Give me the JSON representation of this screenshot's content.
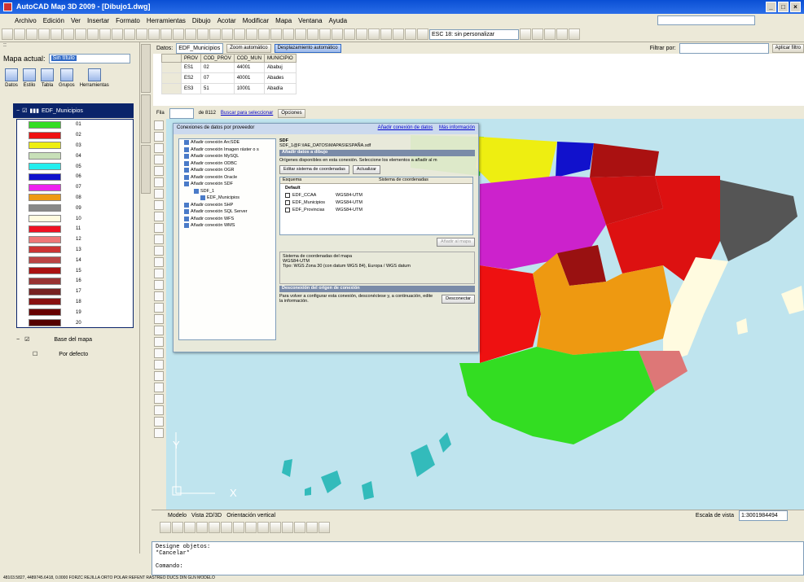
{
  "window": {
    "title": "AutoCAD Map 3D 2009 - [Dibujo1.dwg]"
  },
  "menu": [
    "Archivo",
    "Edición",
    "Ver",
    "Insertar",
    "Formato",
    "Herramientas",
    "Dibujo",
    "Acotar",
    "Modificar",
    "Mapa",
    "Ventana",
    "Ayuda"
  ],
  "toolbar": {
    "layer_select": "ESC 18: sin personalizar"
  },
  "left_panel": {
    "header": "Mapa actual:",
    "map_value": "Sin título",
    "tools": [
      "Datos",
      "Estilo",
      "Tabla",
      "Grupos",
      "Herramientas"
    ],
    "layer_name": "EDF_Municipios",
    "legend": [
      {
        "label": "01",
        "color": "#33dd22"
      },
      {
        "label": "02",
        "color": "#ee1111"
      },
      {
        "label": "03",
        "color": "#eeee11"
      },
      {
        "label": "04",
        "color": "#c8e0b8"
      },
      {
        "label": "05",
        "color": "#22eeee"
      },
      {
        "label": "06",
        "color": "#1111cc"
      },
      {
        "label": "07",
        "color": "#ee22ee"
      },
      {
        "label": "08",
        "color": "#ee9911"
      },
      {
        "label": "09",
        "color": "#888888"
      },
      {
        "label": "10",
        "color": "#fffbe0"
      },
      {
        "label": "11",
        "color": "#ee1122"
      },
      {
        "label": "12",
        "color": "#ee7777"
      },
      {
        "label": "13",
        "color": "#cc3333"
      },
      {
        "label": "14",
        "color": "#bb4444"
      },
      {
        "label": "15",
        "color": "#aa1111"
      },
      {
        "label": "16",
        "color": "#993333"
      },
      {
        "label": "17",
        "color": "#772222"
      },
      {
        "label": "18",
        "color": "#881111"
      },
      {
        "label": "19",
        "color": "#660000"
      },
      {
        "label": "20",
        "color": "#550000"
      }
    ],
    "base_layer": "Base del mapa",
    "default_label": "Por defecto"
  },
  "data_grid": {
    "table_label": "Datos:",
    "table_select": "EDF_Municipios",
    "btn_zoom": "Zoom automático",
    "btn_auto": "Desplazamiento automático",
    "columns": [
      "PROV",
      "COD_PROV",
      "COD_MUN",
      "MUNICIPIO"
    ],
    "rows": [
      [
        "ES1",
        "02",
        "44001",
        "Ababuj"
      ],
      [
        "ES2",
        "07",
        "40001",
        "Abades"
      ],
      [
        "ES3",
        "51",
        "10001",
        "Abadía"
      ]
    ],
    "footer_row": "Fila",
    "footer_count": "de 8112",
    "footer_link": "Buscar para seleccionar",
    "footer_options": "Opciones",
    "filter_label": "Filtrar por:",
    "filter_btn": "Aplicar filtro"
  },
  "dialog": {
    "title": "Conexiones de datos por proveedor",
    "link1": "Añadir conexión de datos",
    "link2": "Más información",
    "tree": [
      "Añadir conexión ArcSDE",
      "Añadir conexión Imagen ráster o s",
      "Añadir conexión MySQL",
      "Añadir conexión ODBC",
      "Añadir conexión OGR",
      "Añadir conexión Oracle",
      "Añadir conexión SDF",
      "SDF_1",
      "EDF_Municipios",
      "Añadir conexión SHP",
      "Añadir conexión SQL Server",
      "Añadir conexión WFS",
      "Añadir conexión WMS"
    ],
    "type_label": "SDF",
    "path": "SDF_1@F:\\IAE_DATOS\\MAPAS\\ESPAÑA.sdf",
    "section1": "Añadir datos a dibujo",
    "desc": "Orígenes disponibles en esta conexión. Seleccione los elementos a añadir al m",
    "btn_crs": "Editar sistema de coordenadas",
    "btn_refresh": "Actualizar",
    "list_cols": [
      "Esquema",
      "Sistema de coordenadas"
    ],
    "list_default": "Default",
    "list_rows": [
      {
        "name": "EDF_CCAA",
        "crs": "WGS84-UTM"
      },
      {
        "name": "EDF_Municipios",
        "crs": "WGS84-UTM"
      },
      {
        "name": "EDF_Provincias",
        "crs": "WGS84-UTM"
      }
    ],
    "btn_add": "Añadir al mapa",
    "group_label": "Sistema de coordenadas del mapa",
    "group_value": "WGS84-UTM",
    "group_desc": "Tipo: WGS Zona 30 (con datum WGS 84), Europa / WGS datum",
    "section2": "Desconexión del origen de conexión",
    "desc2": "Para volver a configurar esta conexión, desconéctese y, a continuación, edite la información.",
    "btn_disconnect": "Desconectar"
  },
  "status_model": {
    "model_tab": "Modelo",
    "view_tab": "Vista 2D/3D",
    "orient_label": "Orientación vertical",
    "scale_label": "Escala de vista",
    "scale_value": "1:3001984494"
  },
  "command": {
    "line1": "Designe objetos:",
    "line2": "*Cancelar*",
    "prompt": "Comando:"
  },
  "bottom_status": "48103.5827, 4489745.6418, 0.0000   FORZC  REJILLA  ORTO  POLAR  REFENT  RASTREO  DUCS  DIN  GLN  MODELO",
  "axis": {
    "x": "X",
    "y": "Y"
  },
  "colors": {
    "sea": "#bfe4ee",
    "titlebar": "#0a4fd4"
  }
}
